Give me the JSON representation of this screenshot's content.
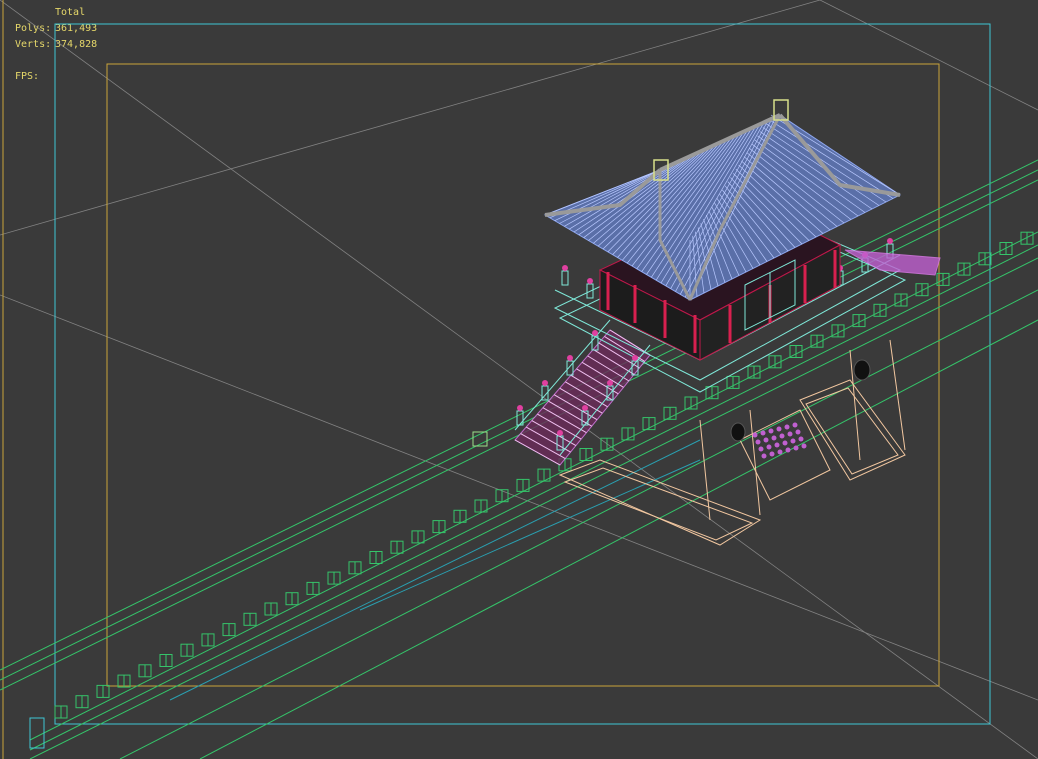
{
  "stats": {
    "total_label": "Total",
    "polys_label": "Polys:",
    "polys_value": "361,493",
    "verts_label": "Verts:",
    "verts_value": "374,828",
    "fps_label": "FPS:",
    "fps_value": ""
  },
  "colors": {
    "background": "#3a3a3a",
    "stats_text": "#e6d86a",
    "safe_frame_outer": "#3fc6d4",
    "safe_frame_inner": "#c9a43a",
    "wall_wire": "#35c46a",
    "roof_wire": "#8fa8f0",
    "column_wire": "#c0184a",
    "rail_wire": "#7fe8d8",
    "gate_wire": "#f2c7a0",
    "grid_line": "#9a9a9a"
  }
}
